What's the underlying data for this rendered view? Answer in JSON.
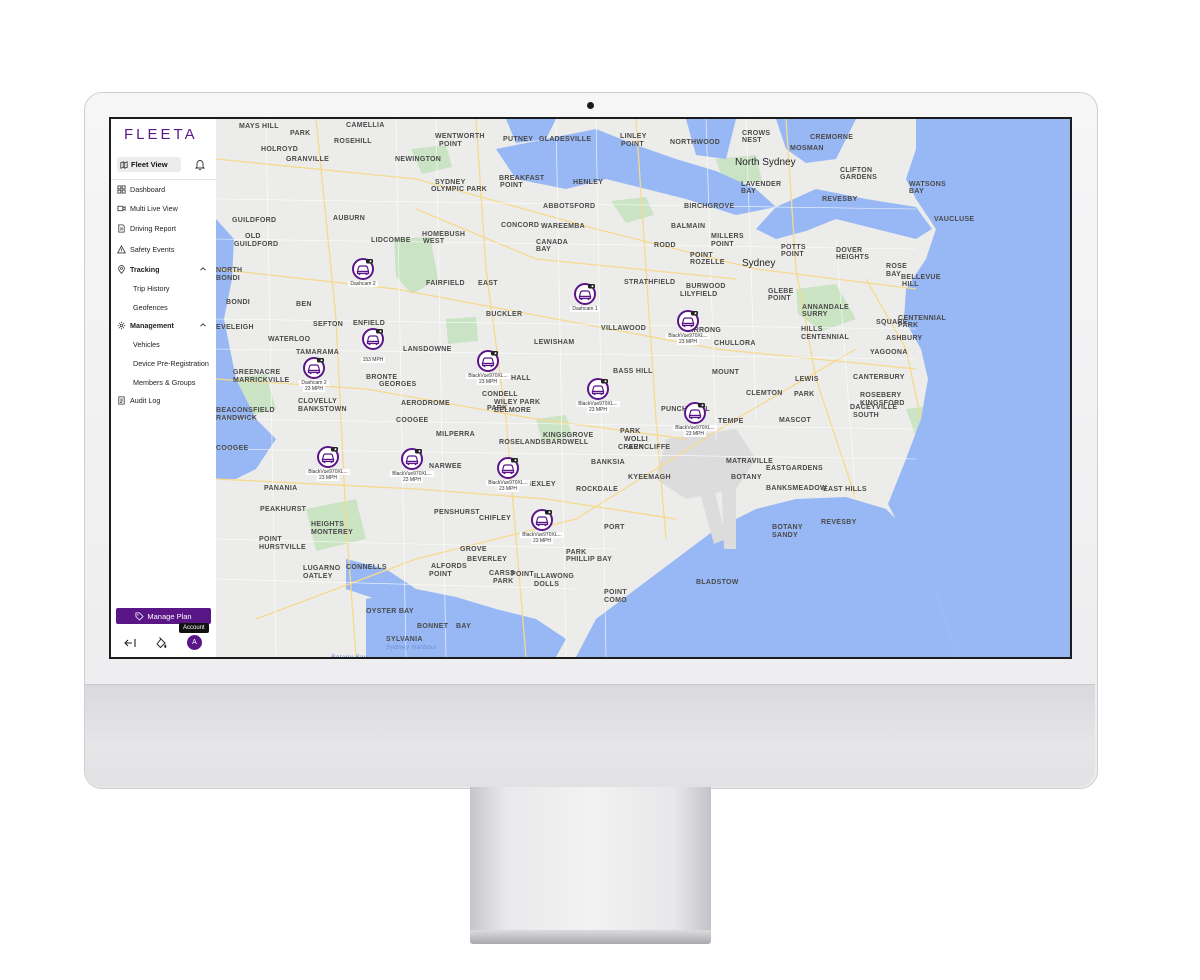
{
  "app": {
    "logo": "FLEETA",
    "current_view": "Fleet View"
  },
  "sidebar": {
    "items": [
      {
        "label": "Dashboard",
        "icon": "grid-icon"
      },
      {
        "label": "Multi Live View",
        "icon": "video-icon"
      },
      {
        "label": "Driving Report",
        "icon": "document-icon"
      },
      {
        "label": "Safety Events",
        "icon": "warning-icon"
      }
    ],
    "tracking": {
      "label": "Tracking",
      "icon": "location-pin-icon",
      "children": [
        "Trip History",
        "Geofences"
      ]
    },
    "management": {
      "label": "Management",
      "icon": "gear-icon",
      "children": [
        "Vehicles",
        "Device Pre-Registration",
        "Members & Groups"
      ]
    },
    "audit": {
      "label": "Audit Log",
      "icon": "audit-log-icon"
    },
    "manage_plan": "Manage Plan",
    "account_tooltip": "Account",
    "avatar_initial": "A"
  },
  "map": {
    "places": [
      "MAYS HILL",
      "CAMELLIA",
      "PARK",
      "ROSEHILL",
      "WENTWORTH",
      "POINT",
      "PUTNEY",
      "GLADESVILLE",
      "LINLEY",
      "POINT",
      "NORTHWOOD",
      "CROWS",
      "NEST",
      "CREMORNE",
      "HOLROYD",
      "GRANVILLE",
      "NEWINGTON",
      "SYDNEY",
      "OLYMPIC PARK",
      "BREAKFAST",
      "POINT",
      "HENLEY",
      "North Sydney",
      "LAVENDER",
      "BAY",
      "MOSMAN",
      "CLIFTON",
      "GARDENS",
      "WATSONS",
      "BAY",
      "GUILDFORD",
      "AUBURN",
      "ABBOTSFORD",
      "BIRCHGROVE",
      "VAUCLUSE",
      "OLD",
      "GUILDFORD",
      "LIDCOMBE",
      "HOMEBUSH",
      "WEST",
      "CONCORD",
      "WAREEMBA",
      "BALMAIN",
      "MILLERS",
      "POINT",
      "CANADA",
      "BAY",
      "RODD",
      "POINT",
      "ROZELLE",
      "Sydney",
      "POTTS",
      "POINT",
      "DOVER",
      "HEIGHTS",
      "ROSE",
      "BAY",
      "BELLEVUE",
      "HILL",
      "NORTH",
      "BONDI",
      "FAIRFIELD",
      "EAST",
      "STRATHFIELD",
      "BURWOOD",
      "LILYFIELD",
      "GLEBE",
      "POINT",
      "ANNANDALE",
      "SURRY",
      "HILLS",
      "CENTENNIAL",
      "SQUARE",
      "CENTENNIAL",
      "PARK",
      "BONDI",
      "BEN",
      "BUCKLER",
      "VILLAWOOD",
      "SEFTON",
      "ENFIELD",
      "LEWISHAM",
      "BIRRONG",
      "CHULLORA",
      "ASHBURY",
      "EVELEIGH",
      "WATERLOO",
      "TAMARAMA",
      "LANSDOWNE",
      "BASS HILL",
      "YAGOONA",
      "GREENACRE",
      "MARRICKVILLE",
      "BRONTE",
      "GEORGES",
      "HALL",
      "MOUNT",
      "LEWIS",
      "CANTERBURY",
      "BEACONSFIELD",
      "RANDWICK",
      "CLOVELLY",
      "BANKSTOWN",
      "AERODROME",
      "CONDELL",
      "PARK",
      "WILEY PARK",
      "BELMORE",
      "CLEMTON",
      "PARK",
      "ROSEBERY",
      "KINGSFORD",
      "COOGEE",
      "PUNCHBOWL",
      "TEMPE",
      "MASCOT",
      "DACEYVILLE",
      "SOUTH",
      "COOGEE",
      "MILPERRA",
      "ROSELANDS",
      "KINGSGROVE",
      "BARDWELL",
      "PARK",
      "WOLLI",
      "CREEK",
      "ARNCLIFFE",
      "MATRAVILLE",
      "PANANIA",
      "NARWEE",
      "BANKSIA",
      "BOTANY",
      "EASTGARDENS",
      "KYEEMAGH",
      "BEXLEY",
      "ROCKDALE",
      "BANKSMEADOW",
      "EAST HILLS",
      "PEAKHURST",
      "PENSHURST",
      "CHIFLEY",
      "REVESBY",
      "HEIGHTS",
      "MONTEREY",
      "PORT",
      "BOTANY",
      "SANDY",
      "POINT",
      "HURSTVILLE",
      "GROVE",
      "BEVERLEY",
      "PARK",
      "PHILLIP BAY",
      "ALFORDS",
      "POINT",
      "LUGARNO",
      "OATLEY",
      "CONNELLS",
      "POINT",
      "CARSS",
      "PARK",
      "ILLAWONG",
      "DOLLS",
      "POINT",
      "COMO",
      "OYSTER BAY",
      "BONNET",
      "BAY",
      "SYLVANIA",
      "Sydney Harbour",
      "Botany Bay",
      "REVESBY",
      "BLADSTOW"
    ]
  },
  "vehicles": [
    {
      "name": "Dashcam 2",
      "speed": ""
    },
    {
      "name": "Dashcam 1",
      "speed": ""
    },
    {
      "name": "BlackVue970XL...",
      "speed": "23 MPH"
    },
    {
      "name": "",
      "speed": "153 MPH"
    },
    {
      "name": "Dashcam 2",
      "speed": "23 MPH"
    },
    {
      "name": "BlackVue970XL...",
      "speed": "23 MPH"
    },
    {
      "name": "BlackVue970XL...",
      "speed": "23 MPH"
    },
    {
      "name": "BlackVue970XL...",
      "speed": "23 MPH"
    },
    {
      "name": "BlackVue970XL...",
      "speed": "23 MPH"
    },
    {
      "name": "BlackVue970XL...",
      "speed": "23 MPH"
    },
    {
      "name": "BlackVue970XL...",
      "speed": "23 MPH"
    },
    {
      "name": "BlackVue970XL...",
      "speed": "23 MPH"
    }
  ]
}
